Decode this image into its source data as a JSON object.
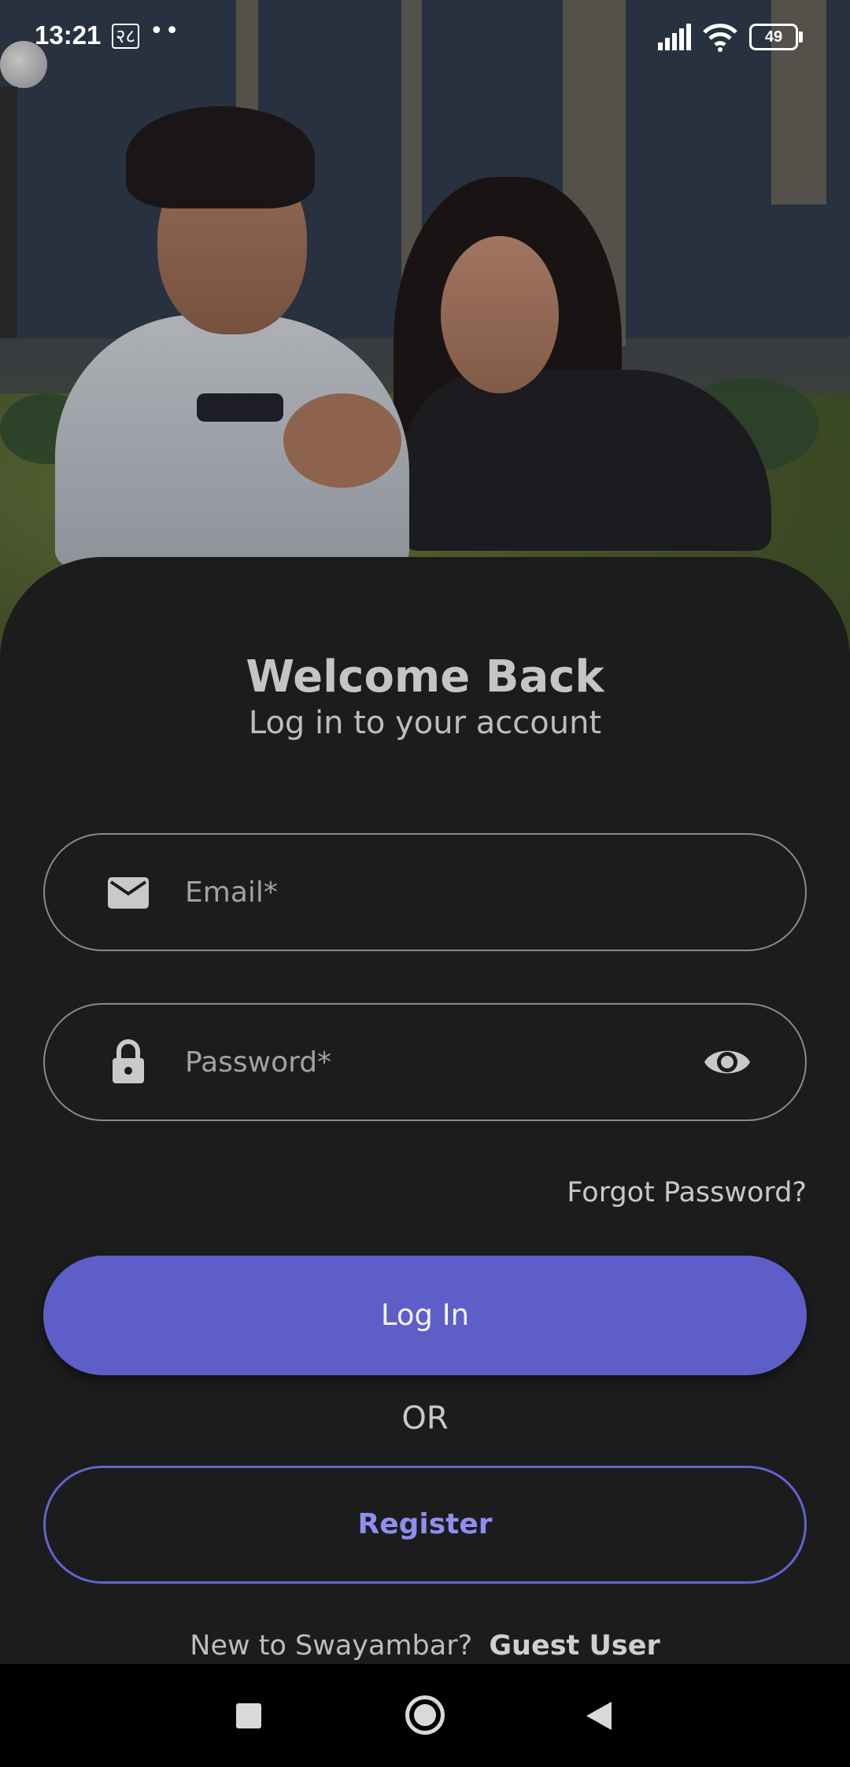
{
  "status_bar": {
    "time": "13:21",
    "extra_icon_text": "२८",
    "dots": "••",
    "battery_level": "49"
  },
  "login": {
    "title": "Welcome Back",
    "subtitle": "Log in to your account",
    "email_placeholder": "Email*",
    "password_placeholder": "Password*",
    "forgot_password": "Forgot Password?",
    "login_button": "Log In",
    "or_label": "OR",
    "register_button": "Register",
    "new_user_text": "New to Swayambar?",
    "guest_user_link": "Guest User"
  },
  "icons": {
    "email": "email-icon",
    "lock": "lock-icon",
    "visibility": "eye-icon",
    "signal": "signal-icon",
    "wifi": "wifi-icon",
    "battery": "battery-icon",
    "nav_recent": "square-icon",
    "nav_home": "circle-icon",
    "nav_back": "triangle-back-icon"
  },
  "colors": {
    "background": "#1c1c1c",
    "primary": "#5e5ec9",
    "register_border": "#6363d2",
    "register_text": "#8f8ff0",
    "text": "#c5c5c5"
  }
}
